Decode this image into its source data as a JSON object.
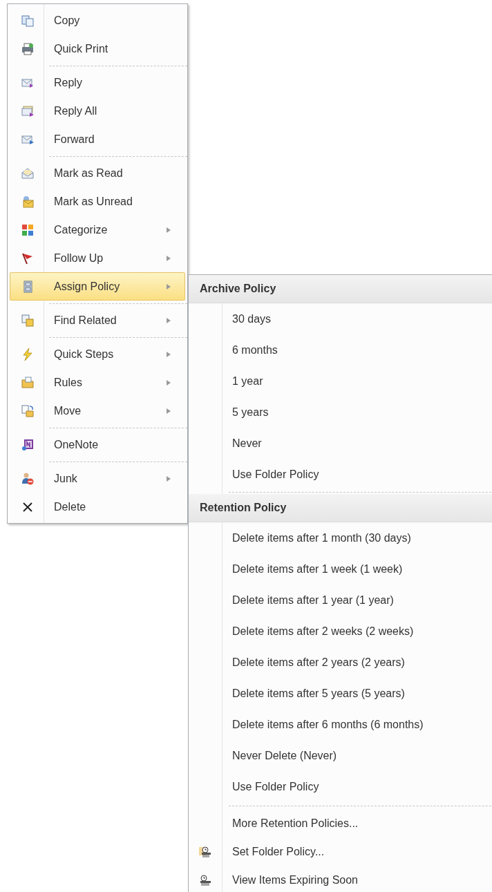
{
  "context_menu": {
    "items": [
      {
        "kind": "item",
        "label": "Copy",
        "submenu": false,
        "selected": false
      },
      {
        "kind": "item",
        "label": "Quick Print",
        "submenu": false,
        "selected": false
      },
      {
        "kind": "separator"
      },
      {
        "kind": "item",
        "label": "Reply",
        "submenu": false,
        "selected": false
      },
      {
        "kind": "item",
        "label": "Reply All",
        "submenu": false,
        "selected": false
      },
      {
        "kind": "item",
        "label": "Forward",
        "submenu": false,
        "selected": false
      },
      {
        "kind": "separator"
      },
      {
        "kind": "item",
        "label": "Mark as Read",
        "submenu": false,
        "selected": false
      },
      {
        "kind": "item",
        "label": "Mark as Unread",
        "submenu": false,
        "selected": false
      },
      {
        "kind": "item",
        "label": "Categorize",
        "submenu": true,
        "selected": false
      },
      {
        "kind": "item",
        "label": "Follow Up",
        "submenu": true,
        "selected": false
      },
      {
        "kind": "item",
        "label": "Assign Policy",
        "submenu": true,
        "selected": true
      },
      {
        "kind": "separator"
      },
      {
        "kind": "item",
        "label": "Find Related",
        "submenu": true,
        "selected": false
      },
      {
        "kind": "separator"
      },
      {
        "kind": "item",
        "label": "Quick Steps",
        "submenu": true,
        "selected": false
      },
      {
        "kind": "item",
        "label": "Rules",
        "submenu": true,
        "selected": false
      },
      {
        "kind": "item",
        "label": "Move",
        "submenu": true,
        "selected": false
      },
      {
        "kind": "separator"
      },
      {
        "kind": "item",
        "label": "OneNote",
        "submenu": false,
        "selected": false
      },
      {
        "kind": "separator"
      },
      {
        "kind": "item",
        "label": "Junk",
        "submenu": true,
        "selected": false
      },
      {
        "kind": "item",
        "label": "Delete",
        "submenu": false,
        "selected": false
      }
    ]
  },
  "submenu": {
    "entries": [
      {
        "kind": "header",
        "label": "Archive Policy"
      },
      {
        "kind": "option",
        "label": "30 days"
      },
      {
        "kind": "option",
        "label": "6 months"
      },
      {
        "kind": "option",
        "label": "1 year"
      },
      {
        "kind": "option",
        "label": "5 years"
      },
      {
        "kind": "option",
        "label": "Never"
      },
      {
        "kind": "option",
        "label": "Use Folder Policy"
      },
      {
        "kind": "separator"
      },
      {
        "kind": "header",
        "label": "Retention Policy"
      },
      {
        "kind": "option",
        "label": "Delete items after 1 month (30 days)"
      },
      {
        "kind": "option",
        "label": "Delete items after 1 week (1 week)"
      },
      {
        "kind": "option",
        "label": "Delete items after 1 year (1 year)"
      },
      {
        "kind": "option",
        "label": "Delete items after 2 weeks (2 weeks)"
      },
      {
        "kind": "option",
        "label": "Delete items after 2 years (2 years)"
      },
      {
        "kind": "option",
        "label": "Delete items after 5 years (5 years)"
      },
      {
        "kind": "option",
        "label": "Delete items after 6 months (6 months)"
      },
      {
        "kind": "option",
        "label": "Never Delete (Never)"
      },
      {
        "kind": "option",
        "label": "Use Folder Policy"
      },
      {
        "kind": "separator"
      },
      {
        "kind": "action",
        "label": "More Retention Policies..."
      },
      {
        "kind": "action",
        "label": "Set Folder Policy..."
      },
      {
        "kind": "action",
        "label": "View Items Expiring Soon"
      }
    ]
  }
}
